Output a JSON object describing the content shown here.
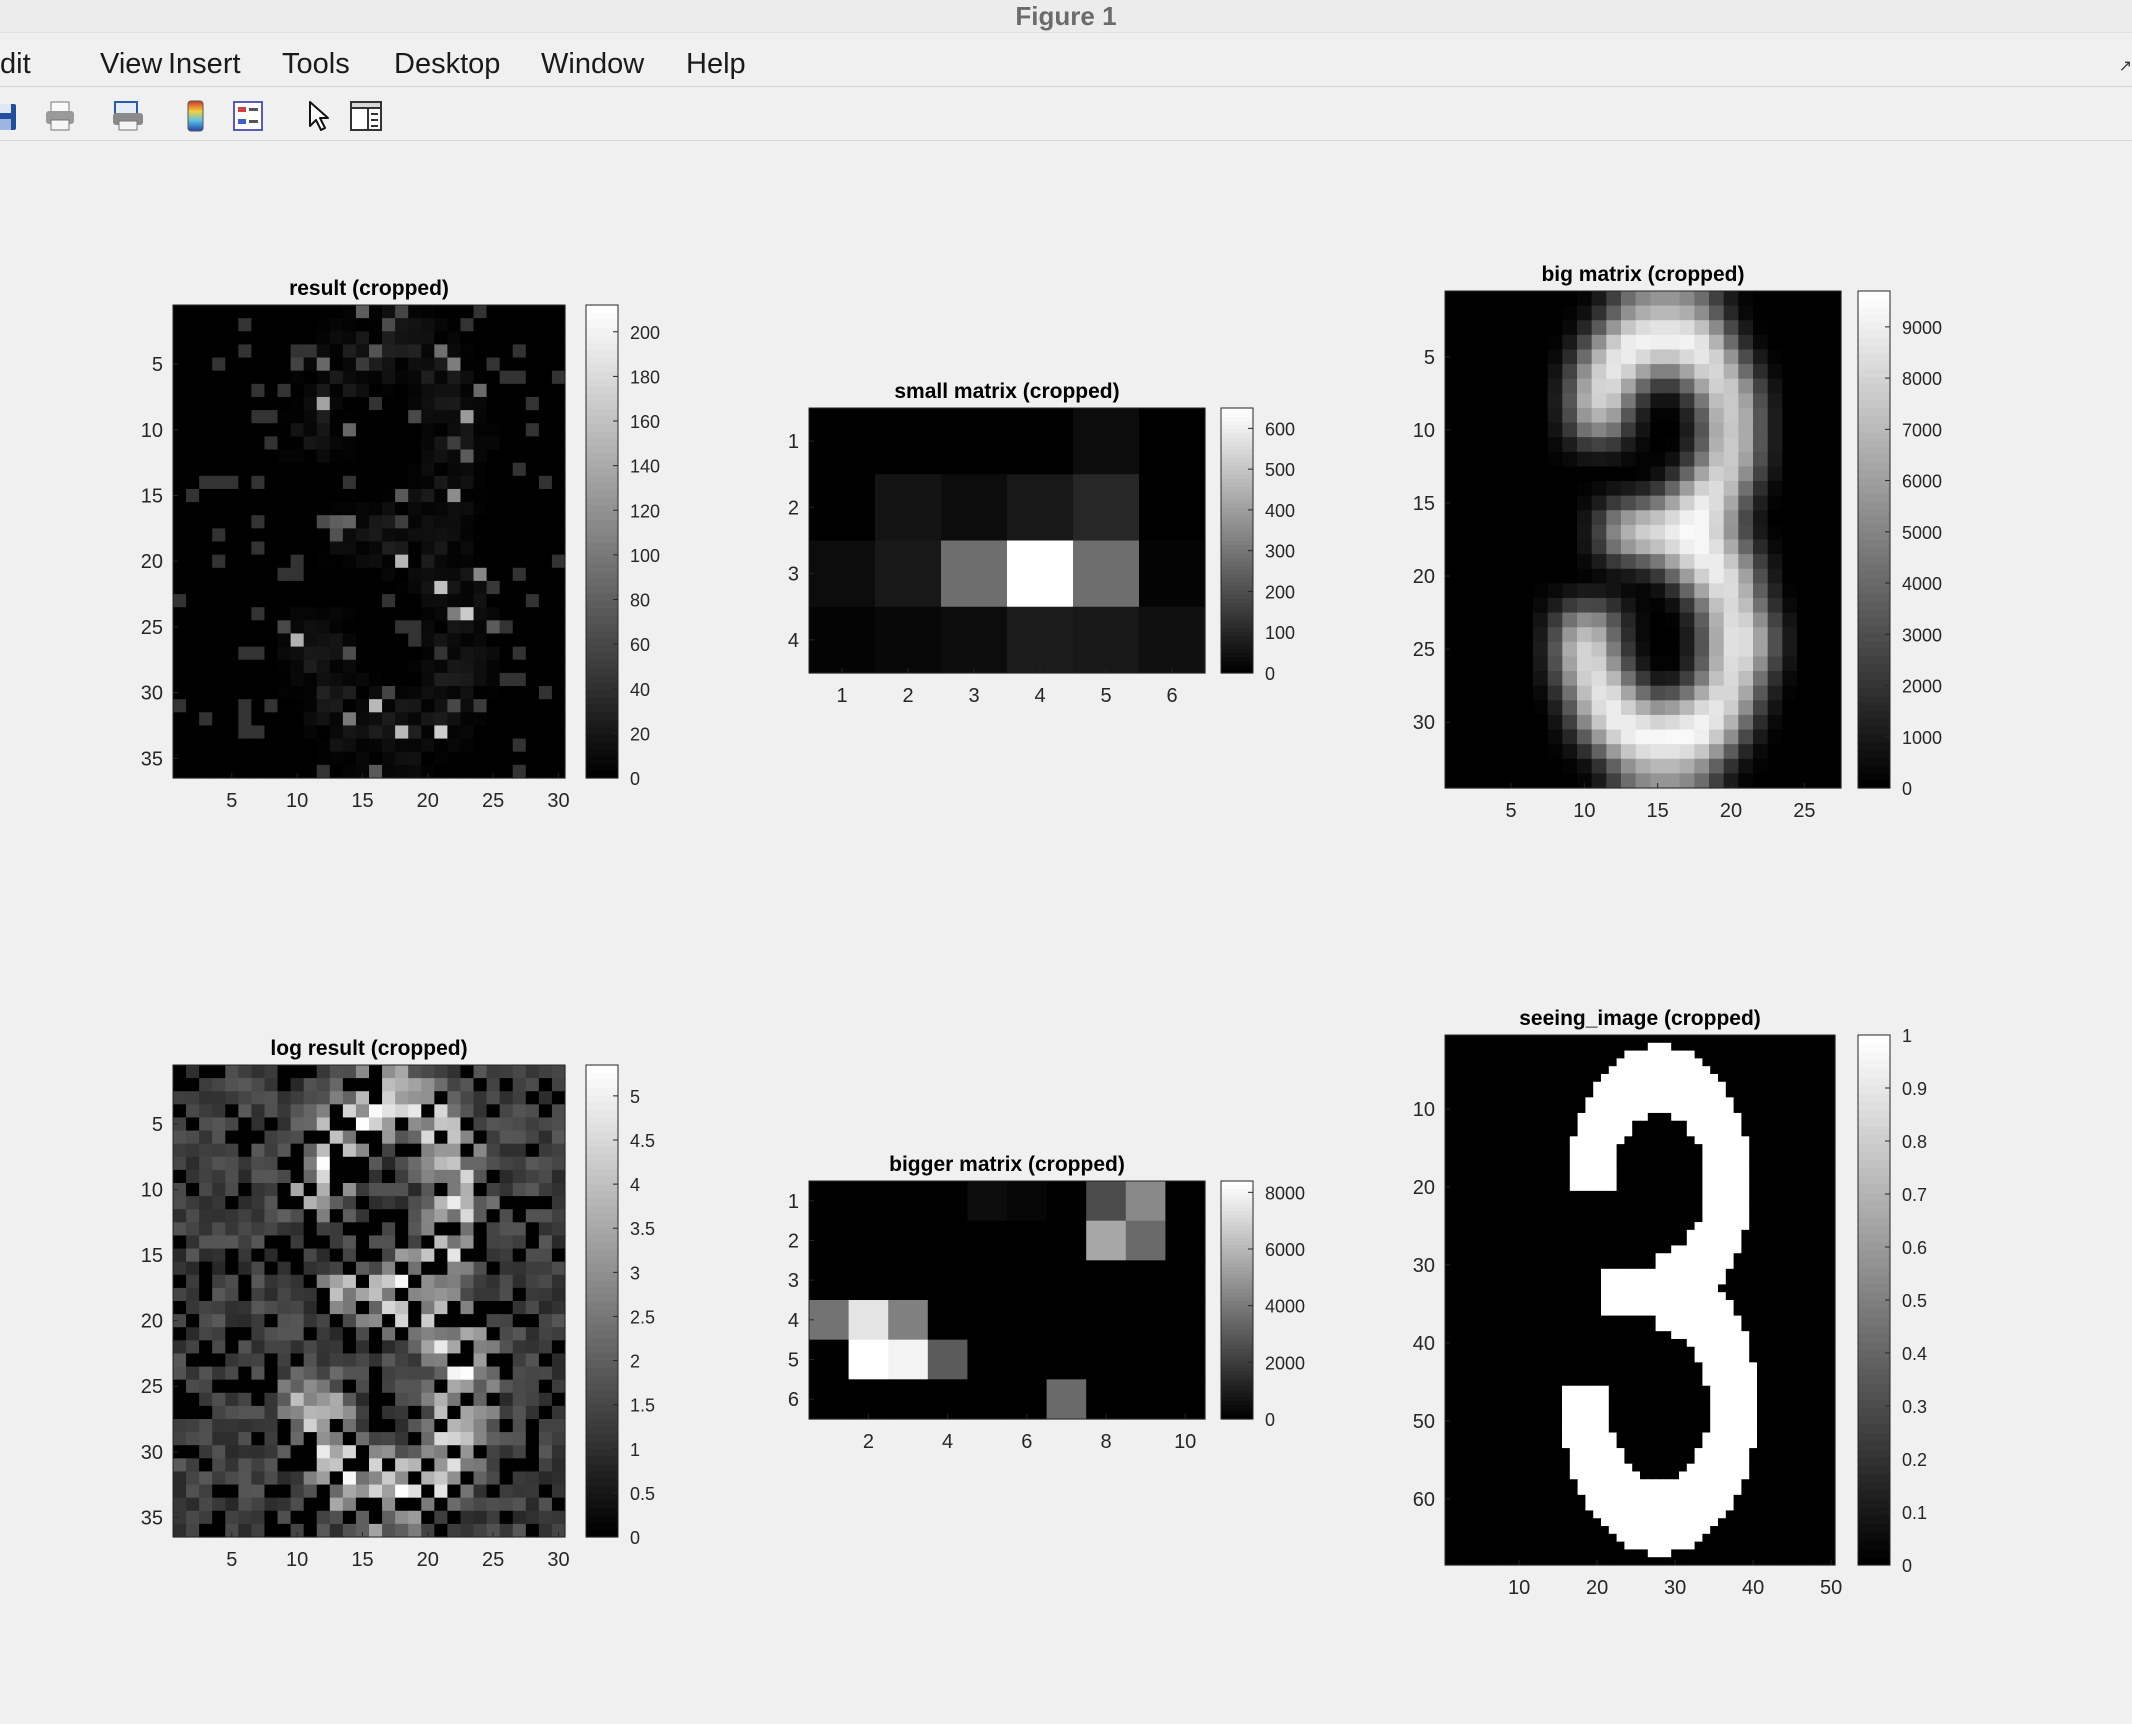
{
  "window": {
    "title": "Figure 1"
  },
  "menu": {
    "items": [
      {
        "id": "edit",
        "label": "dit"
      },
      {
        "id": "view",
        "label": "View"
      },
      {
        "id": "insert",
        "label": "Insert"
      },
      {
        "id": "tools",
        "label": "Tools"
      },
      {
        "id": "desktop",
        "label": "Desktop"
      },
      {
        "id": "window",
        "label": "Window"
      },
      {
        "id": "help",
        "label": "Help"
      }
    ]
  },
  "toolbar": {
    "icons": [
      "save-icon",
      "print-icon",
      "print-preview-icon",
      "insert-colorbar-icon",
      "insert-legend-icon",
      "pointer-icon",
      "property-editor-icon"
    ]
  },
  "colors": {
    "colormap": "gray",
    "figure_bg": "#f0f0f0"
  },
  "chart_data": [
    {
      "type": "heatmap",
      "title": "result (cropped)",
      "colormap": "gray",
      "x_ticks": [
        5,
        10,
        15,
        20,
        25,
        30
      ],
      "y_ticks": [
        5,
        10,
        15,
        20,
        25,
        30,
        35
      ],
      "xlim": [
        0.5,
        30.5
      ],
      "ylim": [
        0.5,
        36.5
      ],
      "colorbar": {
        "ticks": [
          0,
          20,
          40,
          60,
          80,
          100,
          120,
          140,
          160,
          180,
          200
        ],
        "range": [
          0,
          212
        ]
      },
      "pattern": "noise"
    },
    {
      "type": "heatmap",
      "title": "small matrix (cropped)",
      "colormap": "gray",
      "x_ticks": [
        1,
        2,
        3,
        4,
        5,
        6
      ],
      "y_ticks": [
        1,
        2,
        3,
        4
      ],
      "xlim": [
        0.5,
        6.5
      ],
      "ylim": [
        0.5,
        4.5
      ],
      "colorbar": {
        "ticks": [
          0,
          100,
          200,
          300,
          400,
          500,
          600
        ],
        "range": [
          0,
          650
        ]
      },
      "z": [
        [
          0,
          0,
          0,
          0,
          30,
          0
        ],
        [
          0,
          50,
          30,
          60,
          100,
          0
        ],
        [
          30,
          60,
          280,
          650,
          280,
          10
        ],
        [
          10,
          20,
          30,
          70,
          60,
          40
        ]
      ]
    },
    {
      "type": "heatmap",
      "title": "big matrix (cropped)",
      "colormap": "gray",
      "x_ticks": [
        5,
        10,
        15,
        20,
        25
      ],
      "y_ticks": [
        5,
        10,
        15,
        20,
        25,
        30
      ],
      "xlim": [
        0.5,
        27.5
      ],
      "ylim": [
        0.5,
        34.5
      ],
      "colorbar": {
        "ticks": [
          0,
          1000,
          2000,
          3000,
          4000,
          5000,
          6000,
          7000,
          8000,
          9000
        ],
        "range": [
          0,
          9700
        ]
      },
      "pattern": "digit3-blur"
    },
    {
      "type": "heatmap",
      "title": "log result (cropped)",
      "colormap": "gray",
      "x_ticks": [
        5,
        10,
        15,
        20,
        25,
        30
      ],
      "y_ticks": [
        5,
        10,
        15,
        20,
        25,
        30,
        35
      ],
      "xlim": [
        0.5,
        30.5
      ],
      "ylim": [
        0.5,
        36.5
      ],
      "colorbar": {
        "ticks": [
          0,
          0.5,
          1,
          1.5,
          2,
          2.5,
          3,
          3.5,
          4,
          4.5,
          5
        ],
        "range": [
          0,
          5.35
        ]
      },
      "pattern": "lognoise"
    },
    {
      "type": "heatmap",
      "title": "bigger matrix (cropped)",
      "colormap": "gray",
      "x_ticks": [
        2,
        4,
        6,
        8,
        10
      ],
      "y_ticks": [
        1,
        2,
        3,
        4,
        5,
        6
      ],
      "xlim": [
        0.5,
        10.5
      ],
      "ylim": [
        0.5,
        6.5
      ],
      "colorbar": {
        "ticks": [
          0,
          2000,
          4000,
          6000,
          8000
        ],
        "range": [
          0,
          8400
        ]
      },
      "z": [
        [
          0,
          0,
          0,
          0,
          400,
          200,
          0,
          2500,
          4500,
          0
        ],
        [
          0,
          0,
          0,
          0,
          0,
          0,
          0,
          5500,
          3500,
          0
        ],
        [
          0,
          0,
          0,
          0,
          0,
          0,
          0,
          0,
          0,
          0
        ],
        [
          3800,
          7500,
          4200,
          0,
          0,
          0,
          0,
          0,
          0,
          0
        ],
        [
          0,
          8400,
          8000,
          3000,
          0,
          0,
          0,
          0,
          0,
          0
        ],
        [
          0,
          0,
          0,
          0,
          0,
          0,
          3500,
          0,
          0,
          0
        ]
      ]
    },
    {
      "type": "heatmap",
      "title": "seeing_image (cropped)",
      "colormap": "gray",
      "x_ticks": [
        10,
        20,
        30,
        40,
        50
      ],
      "y_ticks": [
        10,
        20,
        30,
        40,
        50,
        60
      ],
      "xlim": [
        0.5,
        50.5
      ],
      "ylim": [
        0.5,
        68.5
      ],
      "colorbar": {
        "ticks": [
          0,
          0.1,
          0.2,
          0.3,
          0.4,
          0.5,
          0.6,
          0.7,
          0.8,
          0.9,
          1
        ],
        "range": [
          0,
          1
        ]
      },
      "pattern": "digit3-binary"
    }
  ]
}
